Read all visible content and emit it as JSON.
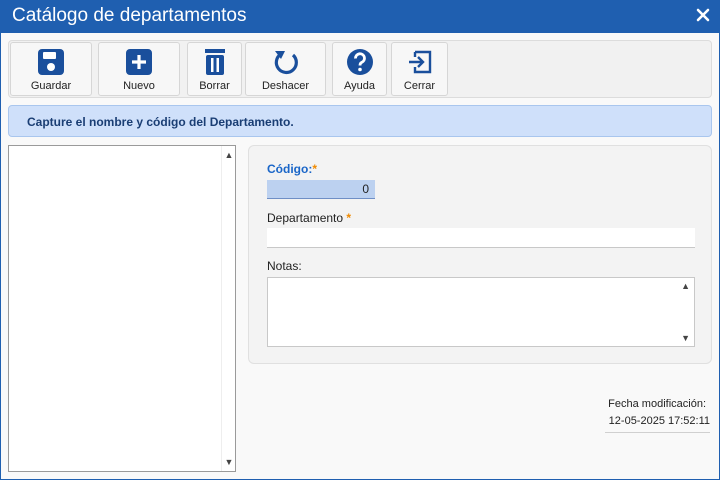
{
  "window": {
    "title": "Catálogo de departamentos",
    "close_icon": "close-icon",
    "accent": "#1f5fb0"
  },
  "toolbar": {
    "icon_color": "#1a4f9c",
    "buttons": [
      {
        "label": "Guardar",
        "icon": "save-icon"
      },
      {
        "label": "Nuevo",
        "icon": "plus-icon"
      },
      {
        "label": "Borrar",
        "icon": "trash-icon"
      },
      {
        "label": "Deshacer",
        "icon": "undo-icon"
      },
      {
        "label": "Ayuda",
        "icon": "help-icon"
      },
      {
        "label": "Cerrar",
        "icon": "exit-icon"
      }
    ]
  },
  "info": {
    "message": "Capture el nombre y código del Departamento."
  },
  "form": {
    "codigo_label": "Código:",
    "codigo_value": "0",
    "required_mark": "*",
    "departamento_label": "Departamento",
    "departamento_value": "",
    "notas_label": "Notas:",
    "notas_value": ""
  },
  "footer": {
    "fecha_label": "Fecha modificación:",
    "fecha_value": "12-05-2025 17:52:11"
  }
}
